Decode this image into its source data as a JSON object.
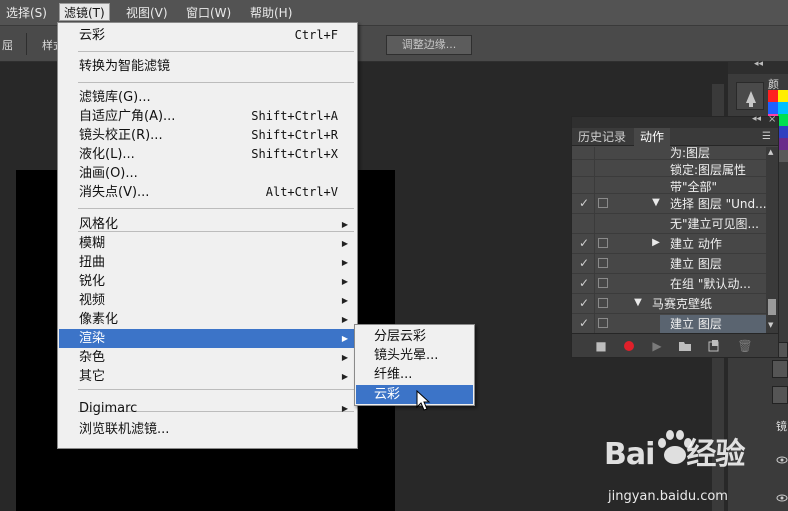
{
  "menubar": {
    "items": [
      "选择(S)",
      "滤镜(T)",
      "视图(V)",
      "窗口(W)",
      "帮助(H)"
    ],
    "active_index": 1
  },
  "options_bar": {
    "left_label_1": "屈",
    "left_label_2": "样式",
    "refine_edge_button": "调整边缘..."
  },
  "filter_menu": {
    "items": [
      {
        "label": "云彩",
        "shortcut": "Ctrl+F"
      },
      {
        "label": "转换为智能滤镜"
      },
      {
        "label": "滤镜库(G)..."
      },
      {
        "label": "自适应广角(A)...",
        "shortcut": "Shift+Ctrl+A"
      },
      {
        "label": "镜头校正(R)...",
        "shortcut": "Shift+Ctrl+R"
      },
      {
        "label": "液化(L)...",
        "shortcut": "Shift+Ctrl+X"
      },
      {
        "label": "油画(O)..."
      },
      {
        "label": "消失点(V)...",
        "shortcut": "Alt+Ctrl+V"
      },
      {
        "label": "风格化",
        "submenu": true
      },
      {
        "label": "模糊",
        "submenu": true
      },
      {
        "label": "扭曲",
        "submenu": true
      },
      {
        "label": "锐化",
        "submenu": true
      },
      {
        "label": "视频",
        "submenu": true
      },
      {
        "label": "像素化",
        "submenu": true
      },
      {
        "label": "渲染",
        "submenu": true,
        "highlighted": true
      },
      {
        "label": "杂色",
        "submenu": true
      },
      {
        "label": "其它",
        "submenu": true
      },
      {
        "label": "Digimarc",
        "submenu": true
      },
      {
        "label": "浏览联机滤镜..."
      }
    ]
  },
  "render_submenu": {
    "items": [
      {
        "label": "分层云彩"
      },
      {
        "label": "镜头光晕..."
      },
      {
        "label": "纤维..."
      },
      {
        "label": "云彩",
        "highlighted": true
      }
    ]
  },
  "panel": {
    "tabs": [
      "历史记录",
      "动作"
    ],
    "active_tab": 1,
    "rows": [
      {
        "label": "为:图层",
        "check": false,
        "box": false,
        "tri": ""
      },
      {
        "label": "锁定:图层属性",
        "check": false,
        "box": false,
        "tri": ""
      },
      {
        "label": "带\"全部\"",
        "check": false,
        "box": false,
        "tri": ""
      },
      {
        "label": "选择 图层 \"Und...",
        "check": true,
        "box": true,
        "tri": "down"
      },
      {
        "label": "无\"建立可见图...",
        "check": false,
        "box": false,
        "tri": ""
      },
      {
        "label": "建立 动作",
        "check": true,
        "box": true,
        "tri": "right"
      },
      {
        "label": "建立 图层",
        "check": true,
        "box": true,
        "tri": ""
      },
      {
        "label": "在组 \"默认动...",
        "check": true,
        "box": true,
        "tri": ""
      },
      {
        "label": "马赛克壁纸",
        "check": true,
        "box": true,
        "tri": "down",
        "indent": "action"
      },
      {
        "label": "建立 图层",
        "check": true,
        "box": true,
        "tri": "",
        "selected": true
      }
    ]
  },
  "right_strip": {
    "panel_label": "颜",
    "label_2": "镜"
  },
  "watermark": {
    "logo_left": "Bai",
    "logo_right": "经验",
    "url": "jingyan.baidu.com"
  },
  "colors": {
    "menu_highlight": "#3c74c8",
    "menu_bg": "#f0f0f0",
    "stop_icon": "#e0202a"
  }
}
